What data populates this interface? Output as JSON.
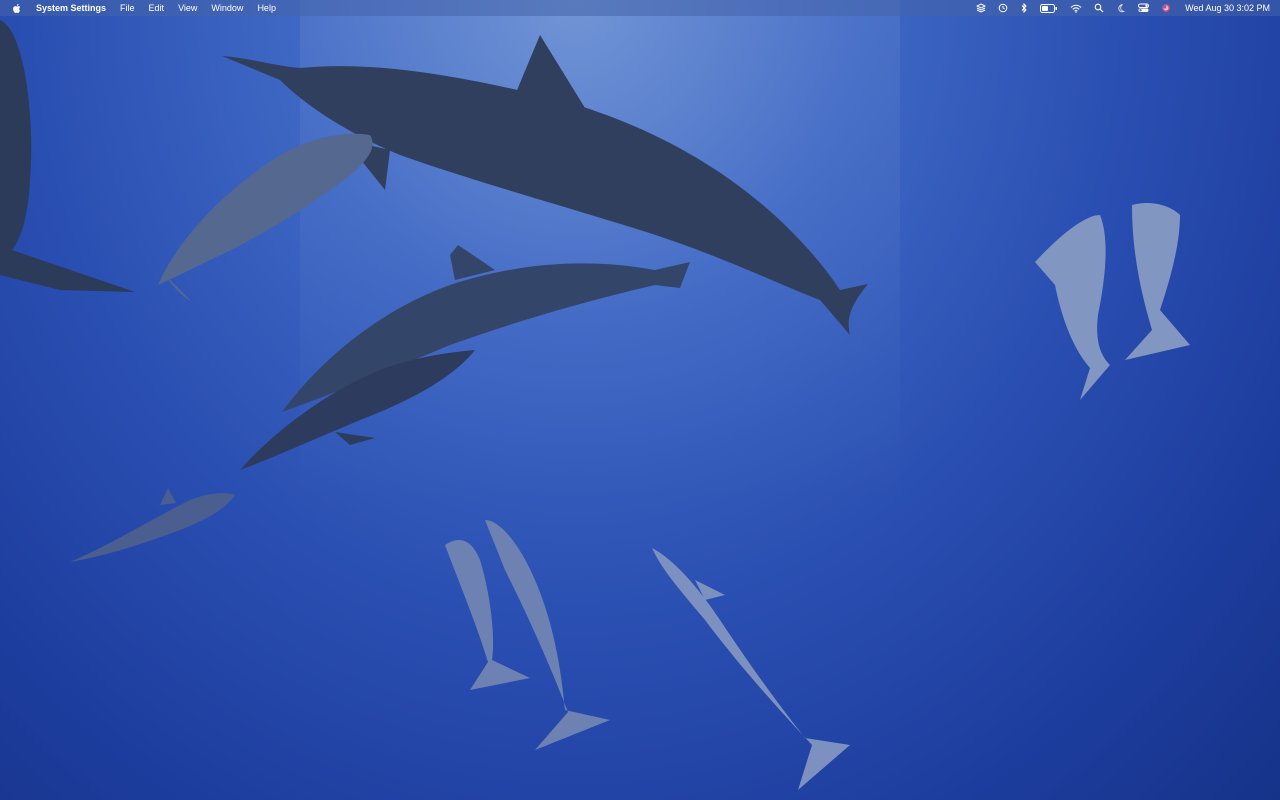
{
  "menubar": {
    "apple_icon": "apple-logo-icon",
    "app_name": "System Settings",
    "menus": [
      "File",
      "Edit",
      "View",
      "Window",
      "Help"
    ],
    "status_icons": [
      "stack-icon",
      "time-machine-icon",
      "bluetooth-icon",
      "battery-icon",
      "wifi-icon",
      "spotlight-search-icon",
      "focus-moon-icon",
      "control-center-icon",
      "siri-icon"
    ],
    "clock": "Wed Aug 30  3:02 PM"
  },
  "desktop": {
    "wallpaper": "dolphins-underwater",
    "colors": {
      "water_top": "#6b8fd3",
      "water_bottom": "#163389",
      "dolphin_dark": "#2e3d5c",
      "dolphin_light": "#7f94bf"
    }
  }
}
